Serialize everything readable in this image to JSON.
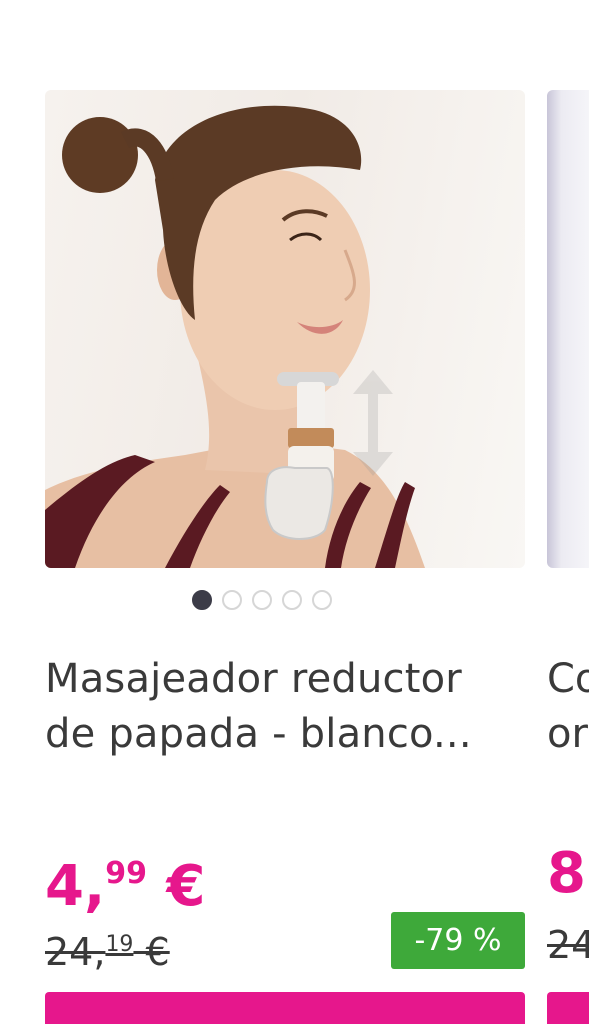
{
  "product": {
    "title": "Masajeador reductor de papada - blanco...",
    "price_int": "4,",
    "price_cents": "99",
    "price_currency": " €",
    "old_price_int": "24,",
    "old_price_cents": "19",
    "old_price_currency": " €",
    "discount": "-79 %",
    "carousel": {
      "total": 5,
      "active_index": 0
    }
  },
  "next_product": {
    "title_partial": "Co\nor",
    "price_partial": "8,",
    "old_price_partial": "24"
  },
  "colors": {
    "brand": "#e6178c",
    "discount": "#3ea93a",
    "text": "#3a3a3a"
  }
}
